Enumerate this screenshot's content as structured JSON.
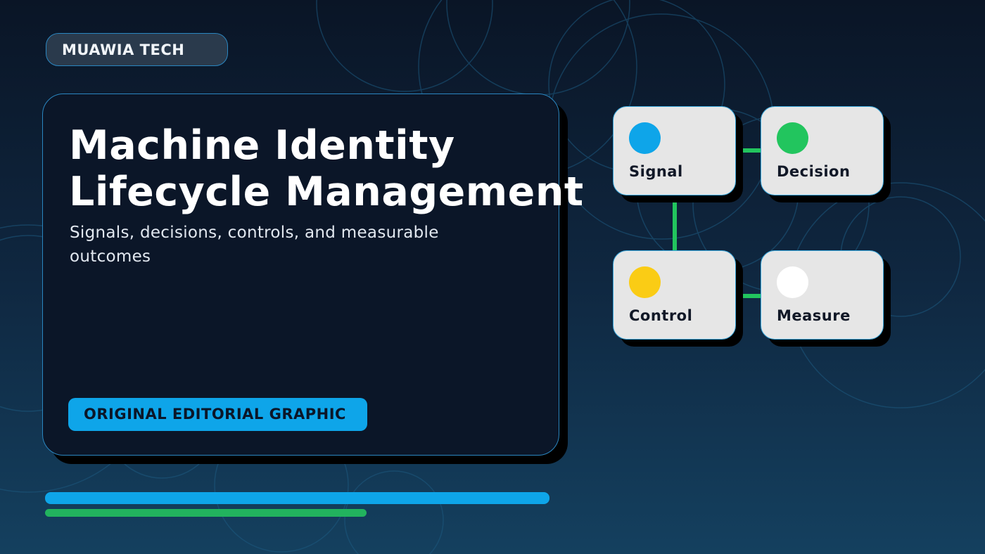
{
  "brand": {
    "label": "MUAWIA TECH"
  },
  "hero": {
    "title_line1": "Machine Identity",
    "title_line2": "Lifecycle Management",
    "subtitle": "Signals, decisions, controls, and measurable outcomes",
    "tag": "ORIGINAL EDITORIAL GRAPHIC"
  },
  "diagram": {
    "nodes": [
      {
        "label": "Signal",
        "color": "#0ea5e9"
      },
      {
        "label": "Decision",
        "color": "#22c55e"
      },
      {
        "label": "Control",
        "color": "#facc15"
      },
      {
        "label": "Measure",
        "color": "#ffffff"
      }
    ],
    "connector_color": "#22c55e"
  },
  "colors": {
    "accent_blue": "#0ea5e9",
    "accent_green": "#22b35e",
    "card_background": "#0b1628",
    "border": "#2a86c0"
  }
}
